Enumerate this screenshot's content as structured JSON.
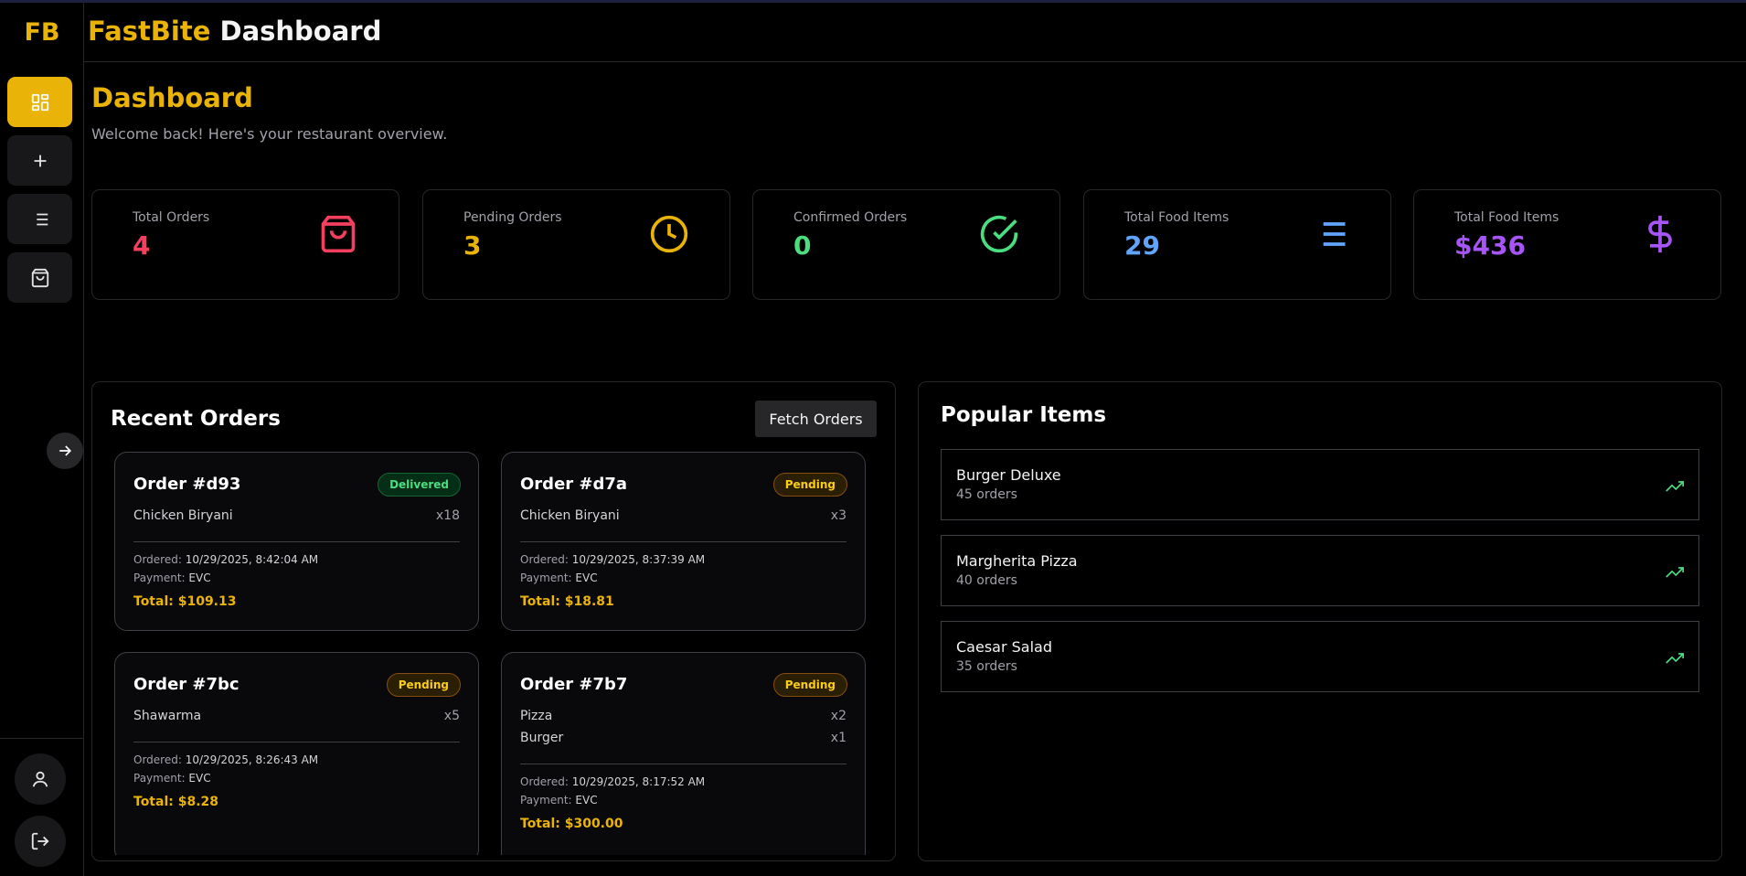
{
  "app": {
    "logo": "FB",
    "brand": "FastBite",
    "title_rest": "Dashboard"
  },
  "page": {
    "title": "Dashboard",
    "subtitle": "Welcome back! Here's your restaurant overview."
  },
  "colors": {
    "accent": "#eab308",
    "red": "#f43f5e",
    "yellow": "#eab308",
    "green": "#4ade80",
    "blue": "#60a5fa",
    "purple": "#a855f7"
  },
  "sidebar": {
    "items": [
      {
        "name": "dashboard",
        "icon": "grid-icon",
        "active": true
      },
      {
        "name": "add",
        "icon": "plus-icon",
        "active": false
      },
      {
        "name": "list",
        "icon": "list-icon",
        "active": false
      },
      {
        "name": "orders",
        "icon": "shopping-bag-icon",
        "active": false
      }
    ],
    "bottom": [
      {
        "name": "profile",
        "icon": "user-icon"
      },
      {
        "name": "logout",
        "icon": "logout-icon"
      }
    ]
  },
  "stats": [
    {
      "label": "Total Orders",
      "value": "4",
      "icon": "shopping-bag-icon",
      "color": "#f43f5e"
    },
    {
      "label": "Pending Orders",
      "value": "3",
      "icon": "clock-icon",
      "color": "#eab308"
    },
    {
      "label": "Confirmed Orders",
      "value": "0",
      "icon": "check-circle-icon",
      "color": "#4ade80"
    },
    {
      "label": "Total Food Items",
      "value": "29",
      "icon": "list-icon",
      "color": "#60a5fa"
    },
    {
      "label": "Total Food Items",
      "value": "$436",
      "icon": "dollar-icon",
      "color": "#a855f7"
    }
  ],
  "recent_orders": {
    "title": "Recent Orders",
    "fetch_label": "Fetch Orders",
    "ordered_label": "Ordered:",
    "payment_label": "Payment:",
    "orders": [
      {
        "id": "Order #d93",
        "status": "Delivered",
        "items": [
          {
            "name": "Chicken Biryani",
            "qty": "x18"
          }
        ],
        "ordered": "10/29/2025, 8:42:04 AM",
        "payment": "EVC",
        "total": "Total: $109.13"
      },
      {
        "id": "Order #d7a",
        "status": "Pending",
        "items": [
          {
            "name": "Chicken Biryani",
            "qty": "x3"
          }
        ],
        "ordered": "10/29/2025, 8:37:39 AM",
        "payment": "EVC",
        "total": "Total: $18.81"
      },
      {
        "id": "Order #7bc",
        "status": "Pending",
        "items": [
          {
            "name": "Shawarma",
            "qty": "x5"
          }
        ],
        "ordered": "10/29/2025, 8:26:43 AM",
        "payment": "EVC",
        "total": "Total: $8.28"
      },
      {
        "id": "Order #7b7",
        "status": "Pending",
        "items": [
          {
            "name": "Pizza",
            "qty": "x2"
          },
          {
            "name": "Burger",
            "qty": "x1"
          }
        ],
        "ordered": "10/29/2025, 8:17:52 AM",
        "payment": "EVC",
        "total": "Total: $300.00"
      }
    ]
  },
  "popular": {
    "title": "Popular Items",
    "items": [
      {
        "name": "Burger Deluxe",
        "orders": "45 orders"
      },
      {
        "name": "Margherita Pizza",
        "orders": "40 orders"
      },
      {
        "name": "Caesar Salad",
        "orders": "35 orders"
      }
    ]
  }
}
